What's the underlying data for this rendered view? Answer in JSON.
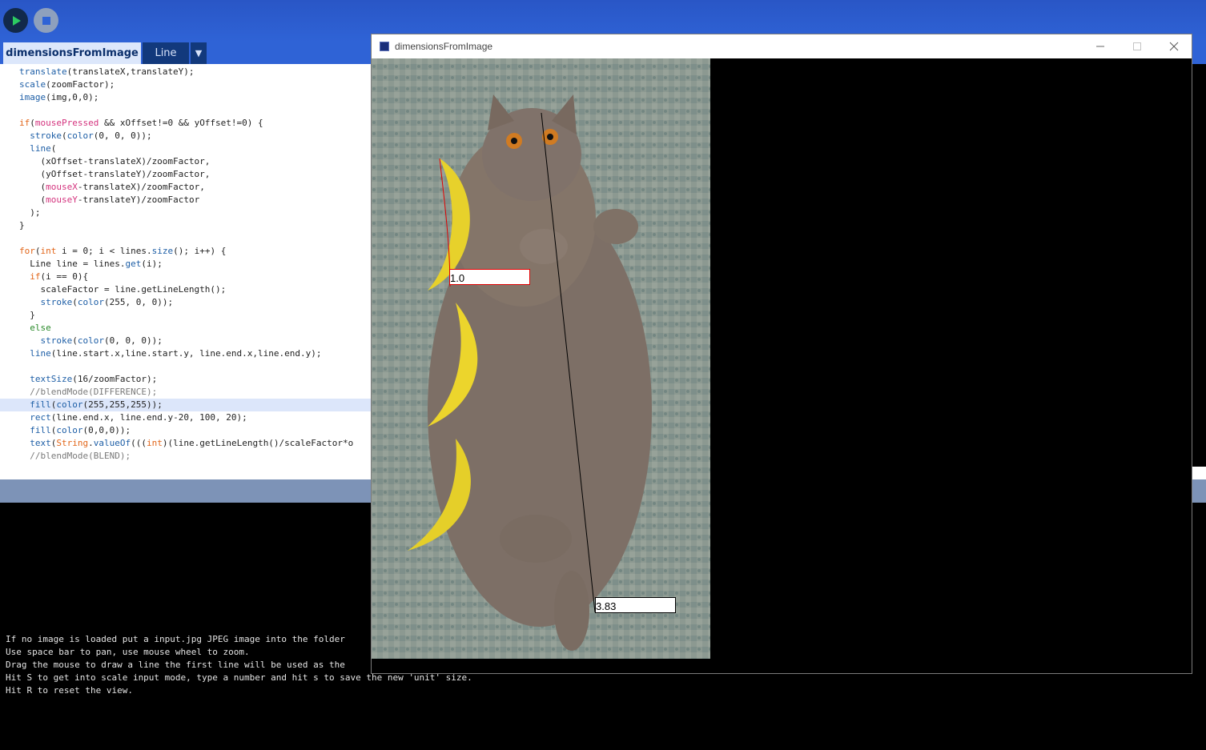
{
  "toolbar": {
    "run_icon": "play-icon",
    "stop_icon": "stop-icon"
  },
  "tabs": [
    {
      "label": "dimensionsFromImage"
    },
    {
      "label": "Line"
    },
    {
      "label": "▼"
    }
  ],
  "editor": {
    "lines": [
      "translate(translateX,translateY);",
      "scale(zoomFactor);",
      "image(img,0,0);",
      "",
      "if(mousePressed && xOffset!=0 && yOffset!=0) {",
      "  stroke(color(0, 0, 0));",
      "  line(",
      "    (xOffset-translateX)/zoomFactor,",
      "    (yOffset-translateY)/zoomFactor,",
      "    (mouseX-translateX)/zoomFactor,",
      "    (mouseY-translateY)/zoomFactor",
      "  );",
      "}",
      "",
      "for(int i = 0; i < lines.size(); i++) {",
      "  Line line = lines.get(i);",
      "  if(i == 0){",
      "    scaleFactor = line.getLineLength();",
      "    stroke(color(255, 0, 0));",
      "  }",
      "  else",
      "    stroke(color(0, 0, 0));",
      "  line(line.start.x,line.start.y, line.end.x,line.end.y);",
      "",
      "  textSize(16/zoomFactor);",
      "  //blendMode(DIFFERENCE);",
      "  fill(color(255,255,255));",
      "  rect(line.end.x, line.end.y-20, 100, 20);",
      "  fill(color(0,0,0));",
      "  text(String.valueOf(((int)(line.getLineLength()/scaleFactor*o",
      "  //blendMode(BLEND);"
    ],
    "highlight_line": 26
  },
  "console": {
    "lines": [
      "If no image is loaded put a input.jpg JPEG image into the folder",
      "Use space bar to pan, use mouse wheel to zoom.",
      "Drag the mouse to draw a line the first line will be used as the",
      "Hit S to get into scale input mode, type a number and hit s to save the new 'unit' size.",
      "Hit R to reset the view."
    ]
  },
  "sketch_window": {
    "title": "dimensionsFromImage",
    "minimize_icon": "minimize-icon",
    "maximize_icon": "maximize-icon",
    "close_icon": "close-icon",
    "labels": {
      "reference_value": "1.0",
      "measured_value": "3.83"
    },
    "colors": {
      "reference_line": "#e00000",
      "measured_line": "#000000"
    }
  }
}
